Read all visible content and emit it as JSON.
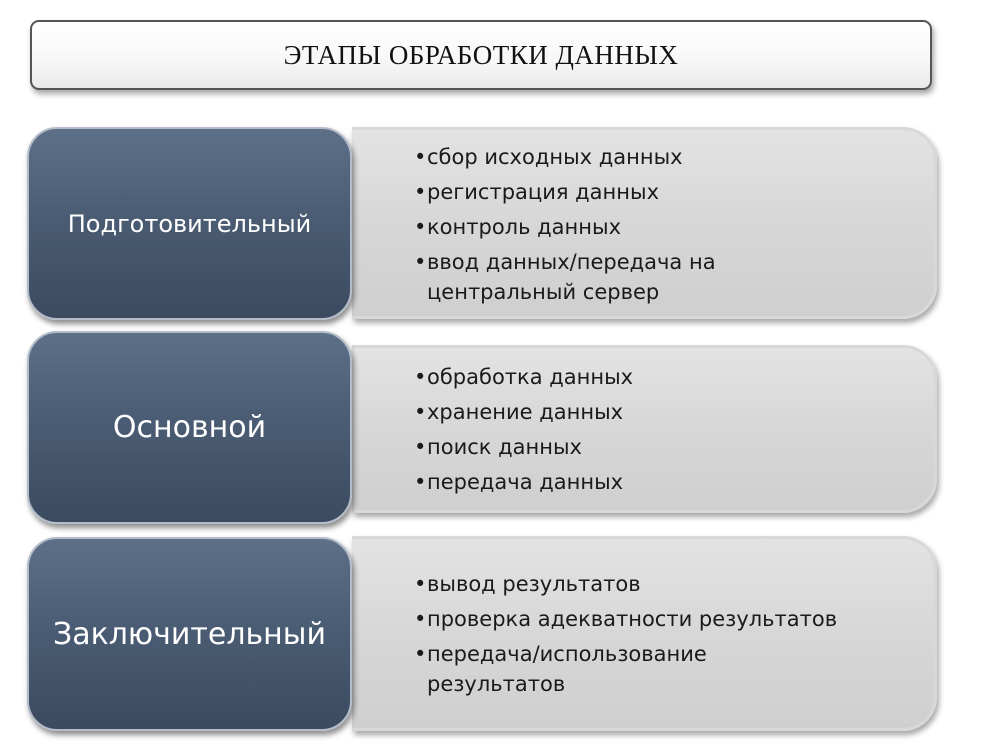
{
  "title": "ЭТАПЫ ОБРАБОТКИ ДАННЫХ",
  "colors": {
    "stage_fill": "#4b5d74",
    "detail_fill": "#d7d7d7",
    "text_dark": "#1a1a1a",
    "text_light": "#ffffff"
  },
  "stages": [
    {
      "label": "Подготовительный",
      "items": [
        "сбор исходных данных",
        "регистрация данных",
        "контроль данных",
        "ввод данных/передача на центральный сервер"
      ]
    },
    {
      "label": "Основной",
      "items": [
        "обработка данных",
        "хранение данных",
        "поиск данных",
        "передача данных"
      ]
    },
    {
      "label": "Заключительный",
      "items": [
        "вывод результатов",
        "проверка адекватности результатов",
        "передача/использование результатов"
      ]
    }
  ]
}
